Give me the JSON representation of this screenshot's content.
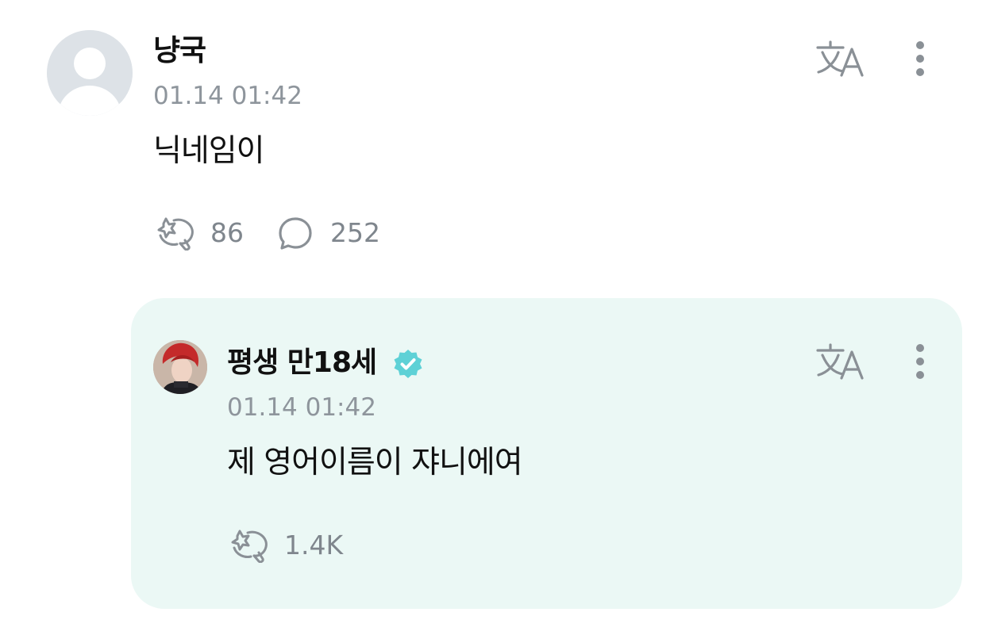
{
  "comment": {
    "username": "냥국",
    "timestamp": "01.14 01:42",
    "text": "닉네임이",
    "like_count": "86",
    "reply_count": "252",
    "icons": {
      "avatar": "default-user-icon",
      "translate": "translate-icon",
      "more": "more-vertical-icon",
      "like": "cheer-hand-icon",
      "reply": "speech-bubble-icon"
    }
  },
  "reply": {
    "username": "평생 만18세",
    "verified": true,
    "timestamp": "01.14 01:42",
    "text": "제 영어이름이 쟈니에여",
    "like_count": "1.4K",
    "icons": {
      "avatar": "artist-profile-photo",
      "verified": "verified-badge-icon",
      "translate": "translate-icon",
      "more": "more-vertical-icon",
      "like": "cheer-hand-icon"
    }
  },
  "colors": {
    "reply_background": "#ebf8f5",
    "verified_badge": "#5ed1d6",
    "muted_text": "#8e959c",
    "icon_gray": "#8a9096"
  }
}
